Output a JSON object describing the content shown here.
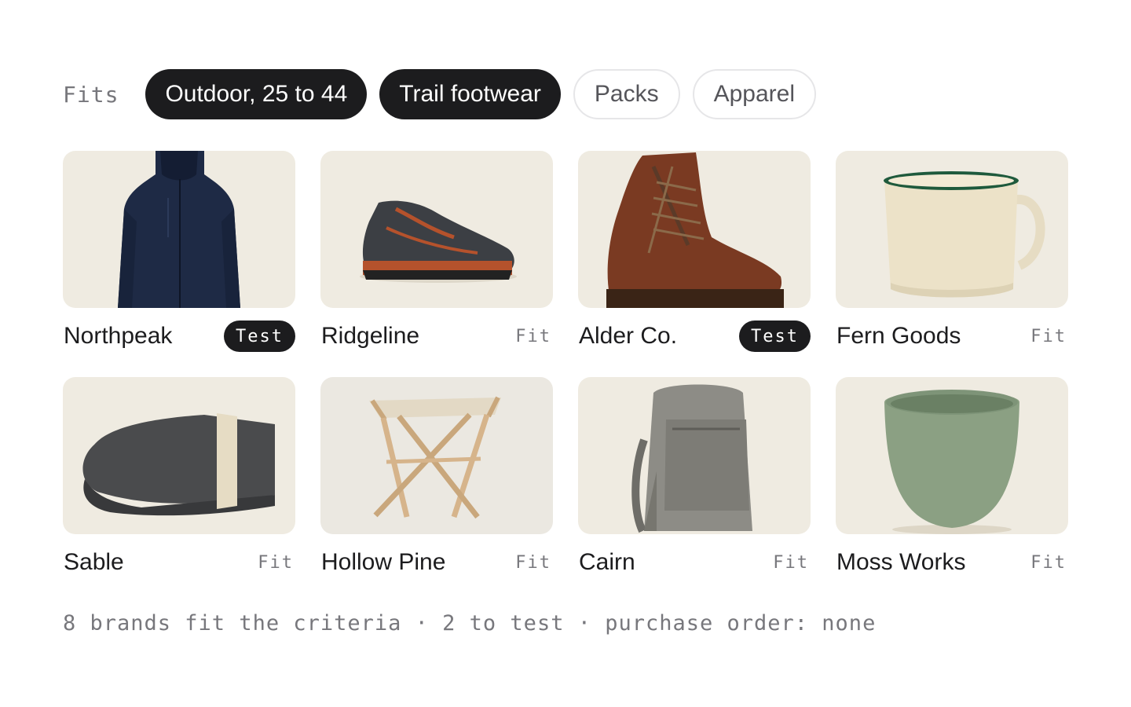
{
  "filters": {
    "label": "Fits",
    "chips": [
      {
        "label": "Outdoor, 25 to 44",
        "active": true
      },
      {
        "label": "Trail footwear",
        "active": true
      },
      {
        "label": "Packs",
        "active": false
      },
      {
        "label": "Apparel",
        "active": false
      }
    ]
  },
  "brands": [
    {
      "name": "Northpeak",
      "status": "Test",
      "image": "navy-rain-jacket"
    },
    {
      "name": "Ridgeline",
      "status": "Fit",
      "image": "trail-running-shoe"
    },
    {
      "name": "Alder Co.",
      "status": "Test",
      "image": "leather-hiking-boot"
    },
    {
      "name": "Fern Goods",
      "status": "Fit",
      "image": "enamel-camp-mug"
    },
    {
      "name": "Sable",
      "status": "Fit",
      "image": "folded-wool-blanket"
    },
    {
      "name": "Hollow Pine",
      "status": "Fit",
      "image": "folding-camp-stool"
    },
    {
      "name": "Cairn",
      "status": "Fit",
      "image": "grey-backpack"
    },
    {
      "name": "Moss Works",
      "status": "Fit",
      "image": "green-ceramic-planter"
    }
  ],
  "summary": "8 brands fit the criteria · 2 to test · purchase order: none",
  "colors": {
    "chip_active_bg": "#1c1c1e",
    "chip_inactive_border": "#e6e6e8",
    "muted_text": "#77777c",
    "photo_background": "#efebe1"
  }
}
